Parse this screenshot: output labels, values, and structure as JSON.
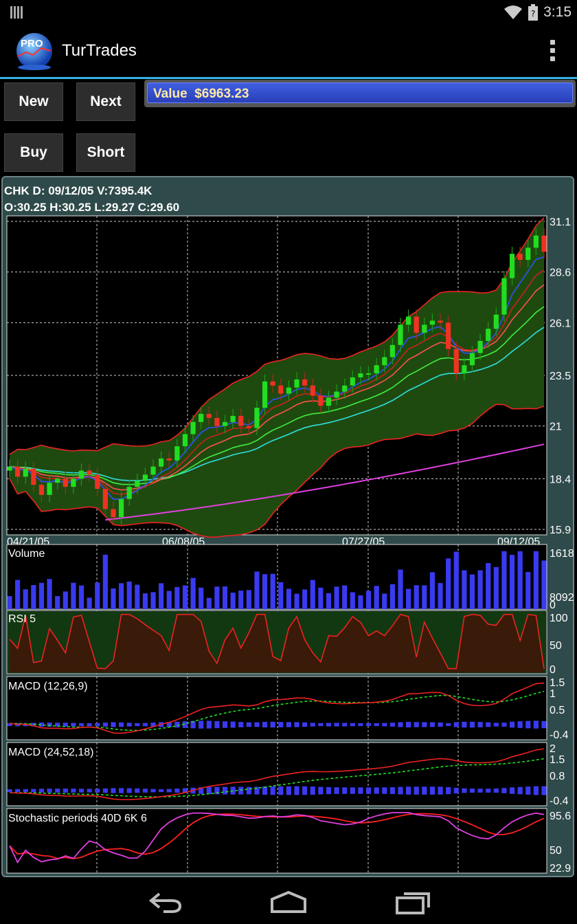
{
  "status_bar": {
    "time": "3:15"
  },
  "app": {
    "title": "TurTrades",
    "logo_text": "PRO"
  },
  "buttons": {
    "new": "New",
    "next": "Next",
    "buy": "Buy",
    "short": "Short"
  },
  "value": {
    "label": "Value",
    "amount": "$6963.23"
  },
  "chart_header": {
    "line1": "CHK D: 09/12/05 V:7395.4K",
    "line2": "O:30.25 H:30.25 L:29.27 C:29.60"
  },
  "colors": {
    "accent": "#33b5e5",
    "up": "#22dd22",
    "down": "#ee3322",
    "volume": "#3a3af0",
    "sma200": "#e040e0"
  },
  "chart_data": [
    {
      "type": "candlestick",
      "title": "CHK D",
      "dates": [
        "04/21/05",
        "06/08/05",
        "07/27/05",
        "09/12/05"
      ],
      "y_ticks": [
        31.1,
        28.6,
        26.1,
        23.5,
        21,
        18.4,
        15.9
      ],
      "ylim": [
        15.9,
        31.1
      ],
      "close_trend": [
        19.0,
        18.5,
        18.9,
        18.1,
        17.6,
        18.2,
        18.4,
        18.0,
        18.4,
        18.8,
        18.6,
        17.9,
        16.9,
        16.5,
        17.4,
        18.0,
        18.3,
        18.6,
        19.0,
        19.4,
        19.3,
        20.0,
        20.6,
        21.2,
        21.6,
        21.4,
        21.0,
        21.2,
        21.5,
        21.0,
        20.9,
        21.9,
        23.2,
        23.0,
        22.6,
        22.9,
        23.3,
        23.0,
        22.5,
        22.0,
        22.4,
        22.7,
        23.0,
        23.4,
        23.6,
        23.6,
        24.0,
        24.4,
        25.0,
        26.0,
        26.4,
        25.6,
        26.0,
        26.2,
        26.1,
        24.8,
        23.6,
        24.0,
        24.6,
        25.2,
        25.8,
        26.5,
        28.3,
        29.5,
        29.2,
        29.8,
        30.4,
        29.6
      ]
    },
    {
      "type": "bar",
      "title": "Volume",
      "y_ticks": [
        "1618",
        "8092",
        "0"
      ]
    },
    {
      "type": "line",
      "title": "RSI 5",
      "y_ticks": [
        "100",
        "50",
        "0"
      ]
    },
    {
      "type": "line",
      "title": "MACD (12,26,9)",
      "y_ticks": [
        "1.5",
        "1",
        "0.5",
        "-0.4"
      ]
    },
    {
      "type": "line",
      "title": "MACD (24,52,18)",
      "y_ticks": [
        "2",
        "1.5",
        "0.8",
        "-0.4"
      ]
    },
    {
      "type": "line",
      "title": "Stochastic periods 40D 6K 6",
      "y_ticks": [
        "95.6",
        "50",
        "22.9"
      ]
    }
  ]
}
